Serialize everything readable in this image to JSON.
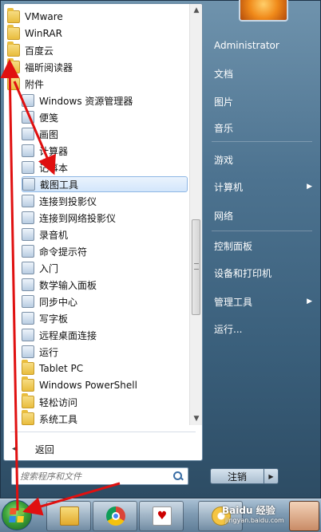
{
  "programs": [
    {
      "label": "VMware",
      "icon": "folder-icon"
    },
    {
      "label": "WinRAR",
      "icon": "folder-icon"
    },
    {
      "label": "百度云",
      "icon": "folder-icon"
    },
    {
      "label": "福昕阅读器",
      "icon": "folder-icon"
    },
    {
      "label": "附件",
      "icon": "folder-icon"
    },
    {
      "label": "Windows 资源管理器",
      "icon": "explorer-icon"
    },
    {
      "label": "便笺",
      "icon": "sticky-notes-icon"
    },
    {
      "label": "画图",
      "icon": "paint-icon"
    },
    {
      "label": "计算器",
      "icon": "calculator-icon"
    },
    {
      "label": "记事本",
      "icon": "notepad-icon"
    },
    {
      "label": "截图工具",
      "icon": "snipping-tool-icon",
      "highlighted": true
    },
    {
      "label": "连接到投影仪",
      "icon": "projector-icon"
    },
    {
      "label": "连接到网络投影仪",
      "icon": "network-projector-icon"
    },
    {
      "label": "录音机",
      "icon": "microphone-icon"
    },
    {
      "label": "命令提示符",
      "icon": "cmd-icon"
    },
    {
      "label": "入门",
      "icon": "getting-started-icon"
    },
    {
      "label": "数学输入面板",
      "icon": "math-input-icon"
    },
    {
      "label": "同步中心",
      "icon": "sync-icon"
    },
    {
      "label": "写字板",
      "icon": "wordpad-icon"
    },
    {
      "label": "远程桌面连接",
      "icon": "remote-desktop-icon"
    },
    {
      "label": "运行",
      "icon": "run-icon"
    },
    {
      "label": "Tablet PC",
      "icon": "folder-icon"
    },
    {
      "label": "Windows PowerShell",
      "icon": "folder-icon"
    },
    {
      "label": "轻松访问",
      "icon": "folder-icon"
    },
    {
      "label": "系统工具",
      "icon": "folder-icon"
    }
  ],
  "back_label": "返回",
  "search_placeholder": "搜索程序和文件",
  "right_menu": [
    {
      "label": "Administrator"
    },
    {
      "label": "文档"
    },
    {
      "label": "图片"
    },
    {
      "label": "音乐"
    },
    {
      "label": "游戏"
    },
    {
      "label": "计算机",
      "submenu": true
    },
    {
      "label": "网络"
    },
    {
      "label": "控制面板"
    },
    {
      "label": "设备和打印机"
    },
    {
      "label": "管理工具",
      "submenu": true
    },
    {
      "label": "运行..."
    }
  ],
  "logout_label": "注销",
  "taskbar": {
    "watermark": "Baidu 经验",
    "watermark_url": "jingyan.baidu.com"
  },
  "colors": {
    "annotation": "#e01010",
    "highlight": "#d3e6fb"
  }
}
